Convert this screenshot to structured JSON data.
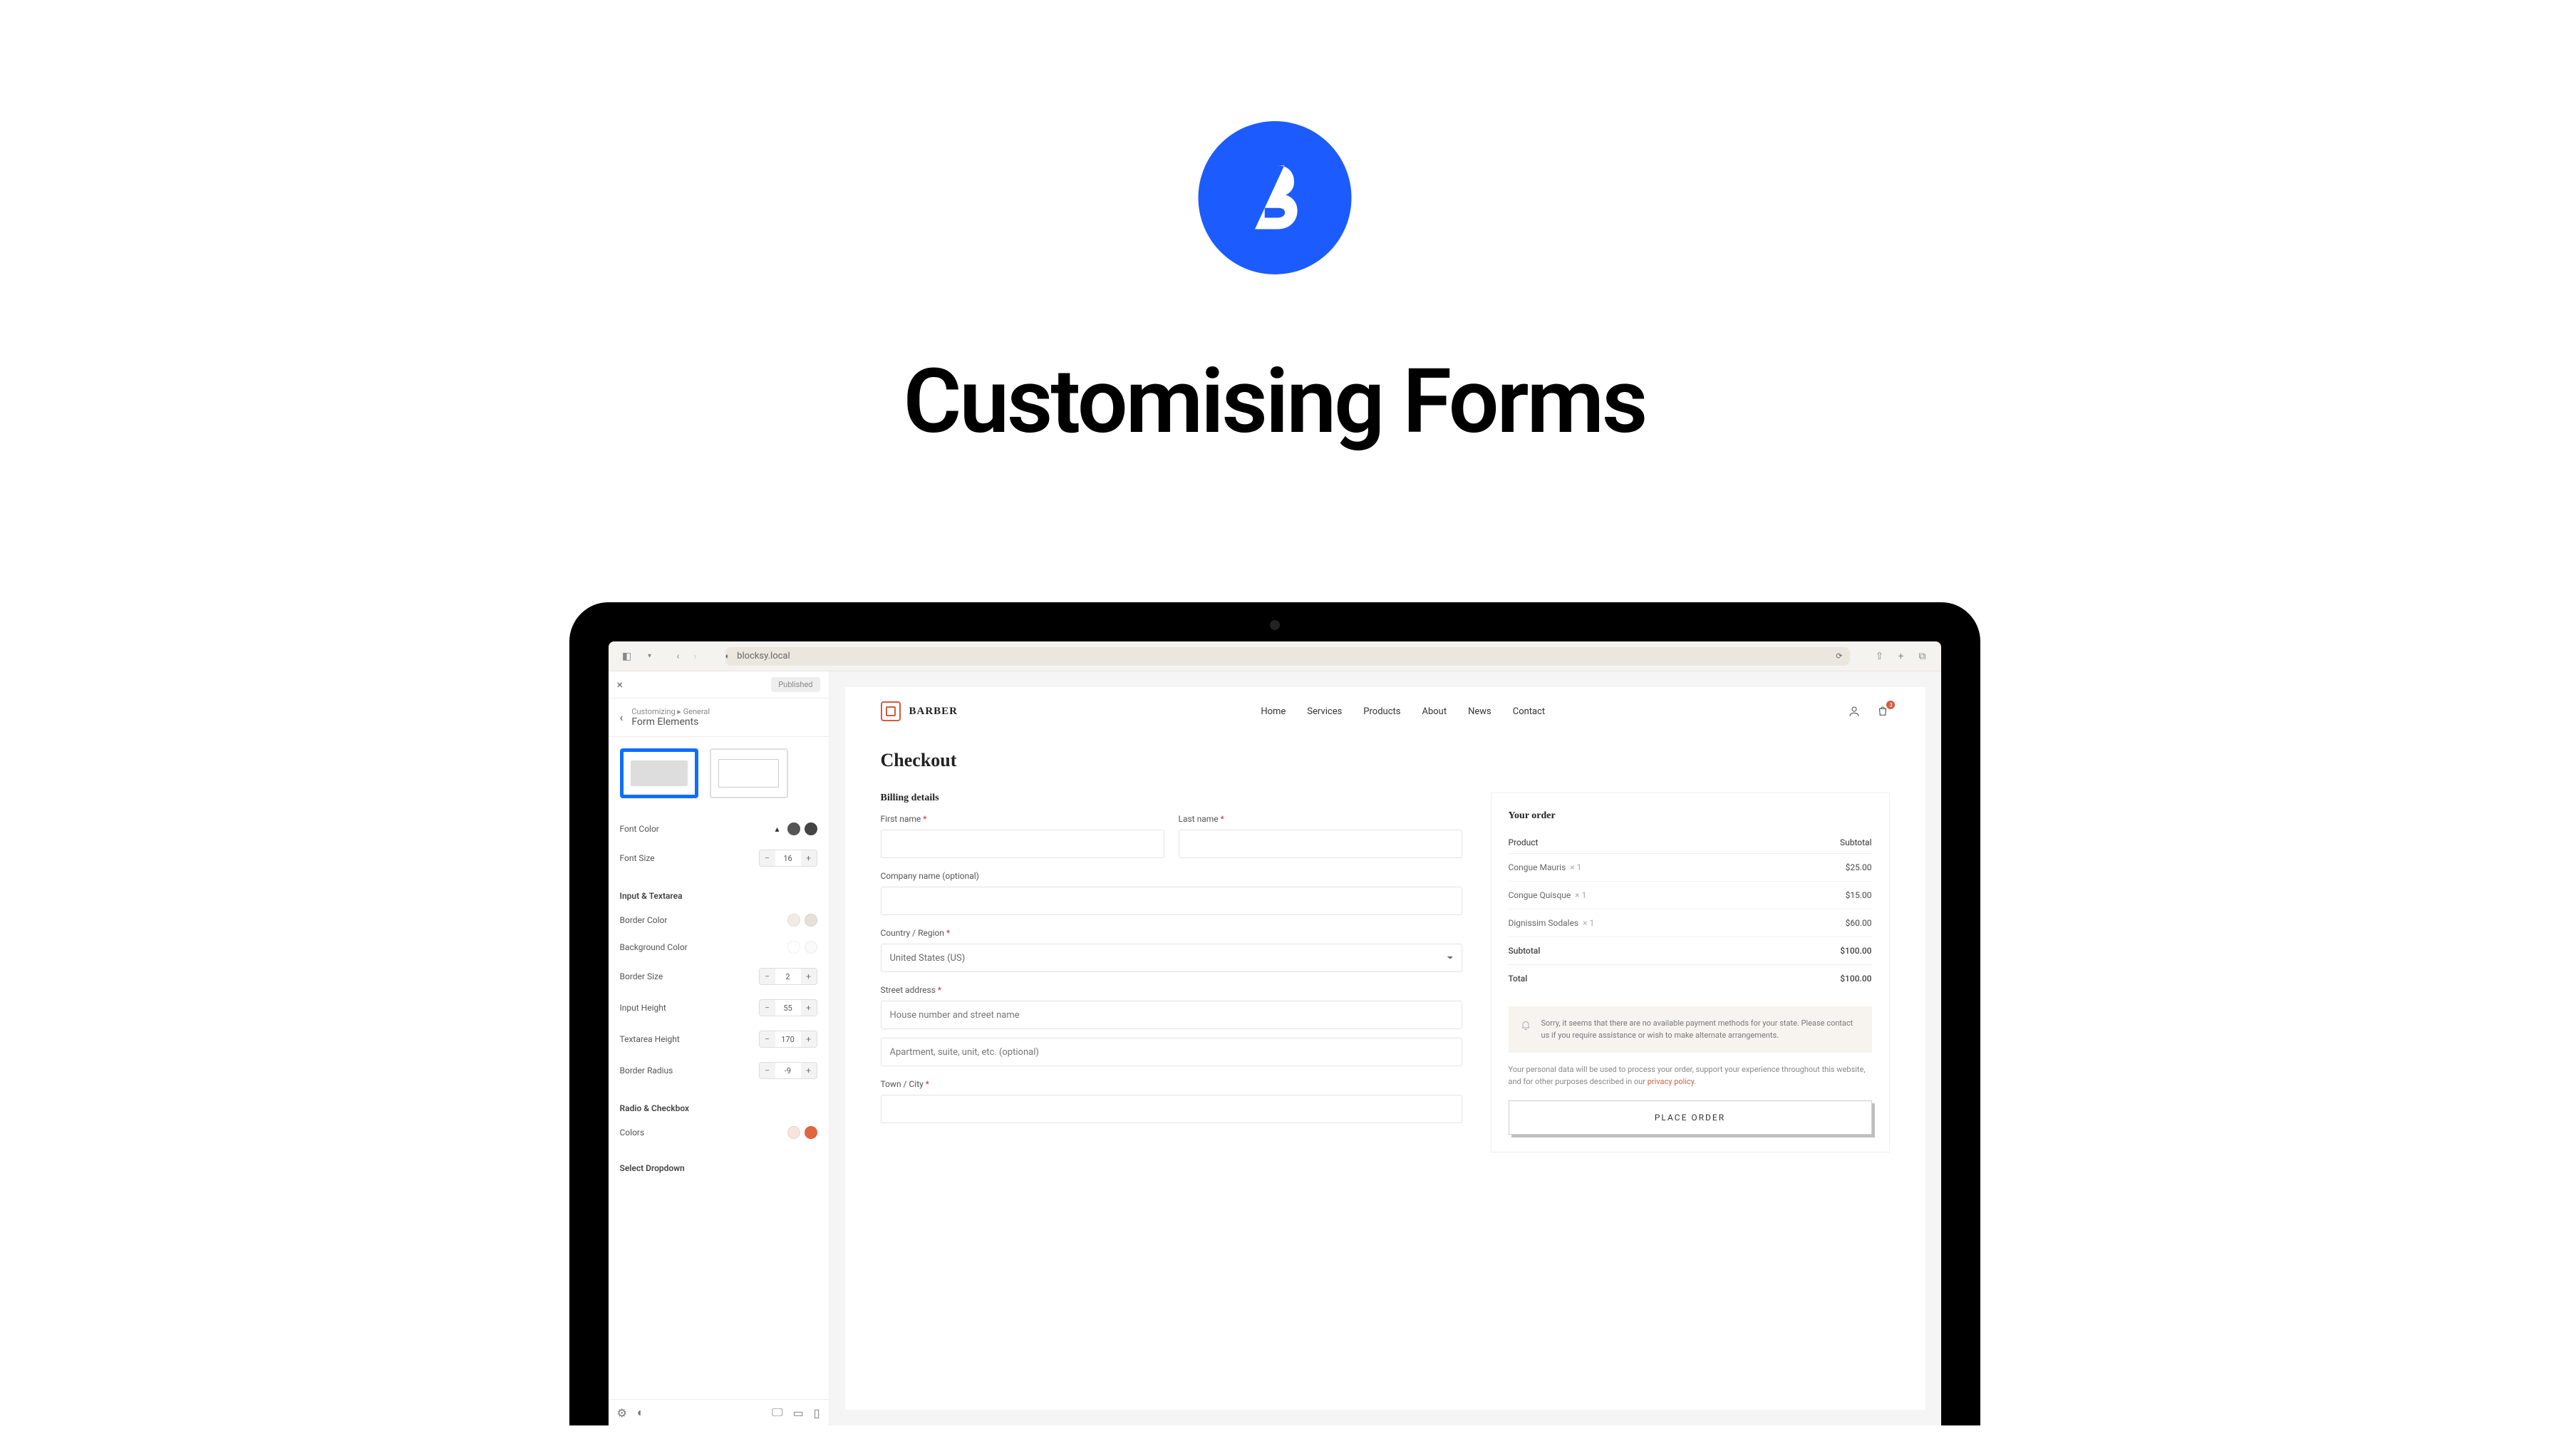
{
  "hero": {
    "title": "Customising Forms"
  },
  "browser": {
    "address": "blocksy.local"
  },
  "customizer": {
    "publish_label": "Published",
    "breadcrumb": "Customizing ▸ General",
    "section": "Form Elements",
    "controls": {
      "font_color_label": "Font Color",
      "font_size_label": "Font Size",
      "font_size_value": "16"
    },
    "groups": {
      "input": {
        "title": "Input & Textarea",
        "border_color_label": "Border Color",
        "background_color_label": "Background Color",
        "border_size_label": "Border Size",
        "border_size_value": "2",
        "input_height_label": "Input Height",
        "input_height_value": "55",
        "textarea_height_label": "Textarea Height",
        "textarea_height_value": "170",
        "border_radius_label": "Border Radius",
        "border_radius_value": "-9"
      },
      "radio": {
        "title": "Radio & Checkbox",
        "colors_label": "Colors"
      },
      "dropdown": {
        "title": "Select Dropdown"
      }
    },
    "colors": {
      "font": [
        "#555555",
        "#444444"
      ],
      "border": [
        "#f0ebe4",
        "#e6e0d8"
      ],
      "background": [
        "#ffffff",
        "#fafafa"
      ],
      "radio": [
        "#f6e4dd",
        "#e2653f"
      ]
    }
  },
  "site": {
    "brand": "BARBER",
    "nav": [
      "Home",
      "Services",
      "Products",
      "About",
      "News",
      "Contact"
    ],
    "cart_count": "3"
  },
  "checkout": {
    "title": "Checkout",
    "billing_title": "Billing details",
    "fields": {
      "first_name": "First name",
      "last_name": "Last name",
      "company": "Company name (optional)",
      "country": "Country / Region",
      "country_value": "United States (US)",
      "street": "Street address",
      "street_ph1": "House number and street name",
      "street_ph2": "Apartment, suite, unit, etc. (optional)",
      "town": "Town / City"
    },
    "order": {
      "title": "Your order",
      "head_product": "Product",
      "head_subtotal": "Subtotal",
      "items": [
        {
          "name": "Congue Mauris",
          "qty": "× 1",
          "price": "$25.00"
        },
        {
          "name": "Congue Quisque",
          "qty": "× 1",
          "price": "$15.00"
        },
        {
          "name": "Dignissim Sodales",
          "qty": "× 1",
          "price": "$60.00"
        }
      ],
      "subtotal_label": "Subtotal",
      "subtotal_value": "$100.00",
      "total_label": "Total",
      "total_value": "$100.00",
      "notice": "Sorry, it seems that there are no available payment methods for your state. Please contact us if you require assistance or wish to make alternate arrangements.",
      "privacy_text": "Your personal data will be used to process your order, support your experience throughout this website, and for other purposes described in our ",
      "privacy_link": "privacy policy",
      "place_order": "PLACE ORDER"
    }
  }
}
